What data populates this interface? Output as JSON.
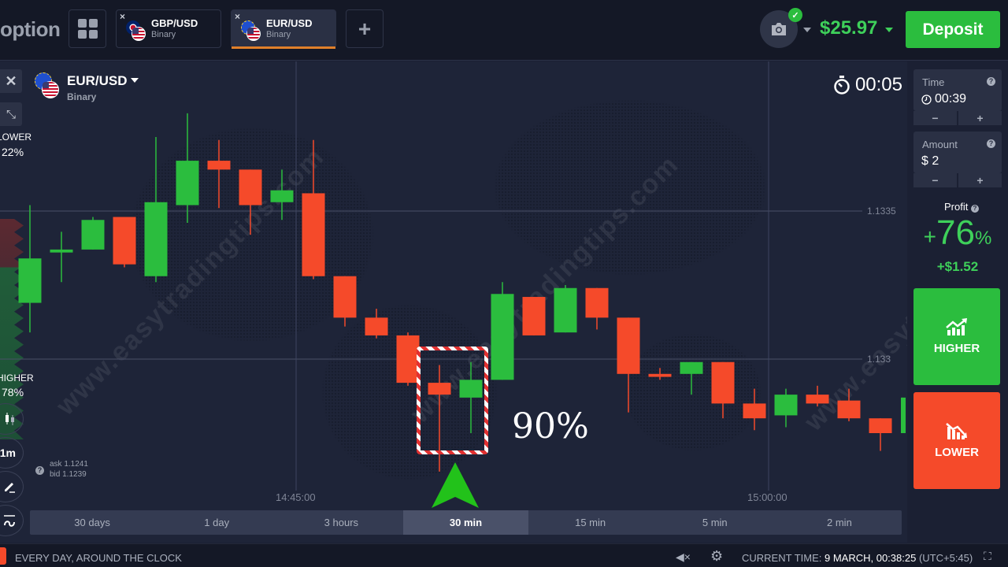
{
  "topbar": {
    "logo": "option",
    "tabs": [
      {
        "pair": "GBP/USD",
        "kind": "Binary",
        "close": "×",
        "flags": [
          "gb-flag",
          "us-flag"
        ],
        "active": false
      },
      {
        "pair": "EUR/USD",
        "kind": "Binary",
        "close": "×",
        "flags": [
          "eu-flag",
          "us-flag"
        ],
        "active": true
      }
    ],
    "add_tab": "+",
    "avatar_icon": "camera-icon",
    "verified_icon": "✓",
    "balance": "$25.97",
    "deposit_label": "Deposit"
  },
  "chart_header": {
    "asset": "EUR/USD",
    "kind": "Binary",
    "timer": "00:05"
  },
  "left_tools": {
    "close": "✕",
    "shrink": "⤡",
    "lower_label": "LOWER",
    "lower_pct": "22%",
    "higher_label": "HIGHER",
    "higher_pct": "78%",
    "interval": "1m",
    "ask": "ask 1.1241",
    "bid": "bid 1.1239",
    "help": "?"
  },
  "annotation": {
    "percent_text": "90%",
    "arrow": "up",
    "watermark": "www.easytradingtips.com"
  },
  "chart_data": {
    "type": "candlestick",
    "y_ticks": [
      1.1335,
      1.133
    ],
    "x_ticks": [
      "14:45:00",
      "15:00:00"
    ],
    "colors": {
      "up": "#2bbd3e",
      "down": "#f54a2a"
    },
    "candles": [
      {
        "o": 1.13319,
        "c": 1.13334,
        "h": 1.13352,
        "l": 1.13309
      },
      {
        "o": 1.13336,
        "c": 1.13337,
        "h": 1.13343,
        "l": 1.13326
      },
      {
        "o": 1.13337,
        "c": 1.13347,
        "h": 1.13348,
        "l": 1.13337
      },
      {
        "o": 1.13348,
        "c": 1.13332,
        "h": 1.13348,
        "l": 1.13331
      },
      {
        "o": 1.13328,
        "c": 1.13353,
        "h": 1.13375,
        "l": 1.13326
      },
      {
        "o": 1.13352,
        "c": 1.13367,
        "h": 1.13383,
        "l": 1.13346
      },
      {
        "o": 1.13367,
        "c": 1.13364,
        "h": 1.13374,
        "l": 1.13351
      },
      {
        "o": 1.13364,
        "c": 1.13352,
        "h": 1.13364,
        "l": 1.13342
      },
      {
        "o": 1.13353,
        "c": 1.13357,
        "h": 1.13364,
        "l": 1.13347
      },
      {
        "o": 1.13356,
        "c": 1.13328,
        "h": 1.13374,
        "l": 1.13327
      },
      {
        "o": 1.13328,
        "c": 1.13314,
        "h": 1.13328,
        "l": 1.13311
      },
      {
        "o": 1.13314,
        "c": 1.13308,
        "h": 1.13317,
        "l": 1.13307
      },
      {
        "o": 1.13308,
        "c": 1.13292,
        "h": 1.13309,
        "l": 1.13291
      },
      {
        "o": 1.13292,
        "c": 1.13288,
        "h": 1.13298,
        "l": 1.13262
      },
      {
        "o": 1.13287,
        "c": 1.13293,
        "h": 1.13299,
        "l": 1.13275
      },
      {
        "o": 1.13293,
        "c": 1.13322,
        "h": 1.13326,
        "l": 1.13293
      },
      {
        "o": 1.13321,
        "c": 1.13308,
        "h": 1.13321,
        "l": 1.13308
      },
      {
        "o": 1.13309,
        "c": 1.13324,
        "h": 1.13325,
        "l": 1.13309
      },
      {
        "o": 1.13324,
        "c": 1.13314,
        "h": 1.13324,
        "l": 1.1331
      },
      {
        "o": 1.13314,
        "c": 1.13295,
        "h": 1.13314,
        "l": 1.13282
      },
      {
        "o": 1.13295,
        "c": 1.13294,
        "h": 1.13297,
        "l": 1.13293
      },
      {
        "o": 1.13295,
        "c": 1.13299,
        "h": 1.13299,
        "l": 1.13288
      },
      {
        "o": 1.13299,
        "c": 1.13285,
        "h": 1.13299,
        "l": 1.1328
      },
      {
        "o": 1.13285,
        "c": 1.1328,
        "h": 1.1329,
        "l": 1.13276
      },
      {
        "o": 1.13281,
        "c": 1.13288,
        "h": 1.1329,
        "l": 1.13277
      },
      {
        "o": 1.13288,
        "c": 1.13285,
        "h": 1.13291,
        "l": 1.13284
      },
      {
        "o": 1.13286,
        "c": 1.1328,
        "h": 1.1329,
        "l": 1.13279
      },
      {
        "o": 1.1328,
        "c": 1.13275,
        "h": 1.1328,
        "l": 1.13269
      },
      {
        "o": 1.13275,
        "c": 1.13287,
        "h": 1.13287,
        "l": 1.13275
      }
    ],
    "highlighted_candles": [
      13,
      14
    ]
  },
  "timeframes": [
    {
      "label": "30 days",
      "active": false
    },
    {
      "label": "1 day",
      "active": false
    },
    {
      "label": "3 hours",
      "active": false
    },
    {
      "label": "30 min",
      "active": true
    },
    {
      "label": "15 min",
      "active": false
    },
    {
      "label": "5 min",
      "active": false
    },
    {
      "label": "2 min",
      "active": false
    }
  ],
  "right_panel": {
    "time_label": "Time",
    "time_value": "00:39",
    "amount_label": "Amount",
    "amount_value": "$ 2",
    "minus": "−",
    "plus": "+",
    "help": "?",
    "profit_label": "Profit",
    "profit_plus": "+",
    "profit_pct": "76",
    "profit_pct_sign": "%",
    "profit_amount": "+$1.52",
    "higher_label": "HIGHER",
    "lower_label": "LOWER"
  },
  "footer": {
    "tagline": "EVERY DAY, AROUND THE CLOCK",
    "current_time_label": "CURRENT TIME:",
    "current_time_value": "9 MARCH, 00:38:25",
    "timezone": "(UTC+5:45)"
  }
}
